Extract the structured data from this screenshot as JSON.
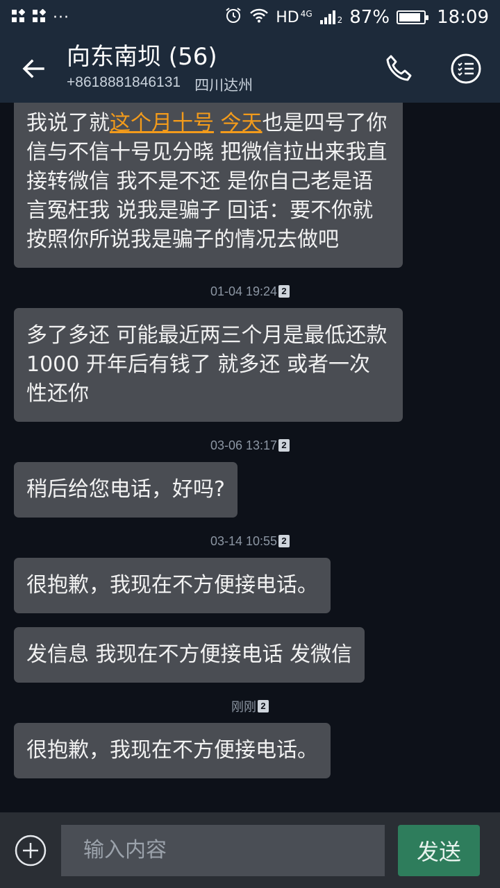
{
  "status_bar": {
    "overflow": "···",
    "network": "HD",
    "network_gen": "4G",
    "sim_slot": "2",
    "battery": "87%",
    "battery_level": 0.87,
    "time": "18:09"
  },
  "header": {
    "title": "向东南坝 (56)",
    "phone": "+8618881846131",
    "location": "四川达州",
    "icons": {
      "back": "arrow-left-icon",
      "call": "phone-icon",
      "menu": "checklist-icon"
    }
  },
  "messages": [
    {
      "type": "bubble",
      "width": "wide",
      "segments": [
        {
          "text": "我说了就"
        },
        {
          "text": "这个月十号",
          "link": true
        },
        {
          "text": " "
        },
        {
          "text": "今天",
          "link": true
        },
        {
          "text": "也是四号了你信与不信十号见分晓 把微信拉出来我直接转微信 我不是不还 是你自己老是语言冤枉我 说我是骗子 回话：要不你就按照你所说我是骗子的情况去做吧"
        }
      ]
    },
    {
      "type": "time",
      "text": "01-04 19:24",
      "sim": "2"
    },
    {
      "type": "bubble",
      "width": "wide",
      "segments": [
        {
          "text": "多了多还 可能最近两三个月是最低还款1000 开年后有钱了 就多还 或者一次性还你"
        }
      ]
    },
    {
      "type": "time",
      "text": "03-06 13:17",
      "sim": "2"
    },
    {
      "type": "bubble",
      "segments": [
        {
          "text": "稍后给您电话，好吗?"
        }
      ]
    },
    {
      "type": "time",
      "text": "03-14 10:55",
      "sim": "2"
    },
    {
      "type": "bubble",
      "segments": [
        {
          "text": "很抱歉，我现在不方便接电话。"
        }
      ]
    },
    {
      "type": "gap"
    },
    {
      "type": "bubble",
      "segments": [
        {
          "text": "发信息 我现在不方便接电话 发微信"
        }
      ]
    },
    {
      "type": "time",
      "text": "刚刚",
      "sim": "2"
    },
    {
      "type": "bubble",
      "segments": [
        {
          "text": "很抱歉，我现在不方便接电话。"
        }
      ]
    }
  ],
  "input": {
    "placeholder": "输入内容",
    "value": "",
    "send_label": "发送",
    "add_icon": "plus-circle-icon"
  },
  "colors": {
    "bar": "#1d2a3a",
    "background": "#0d1119",
    "bubble": "#4a4d53",
    "link": "#f39b1b",
    "send": "#2e7d5c"
  }
}
